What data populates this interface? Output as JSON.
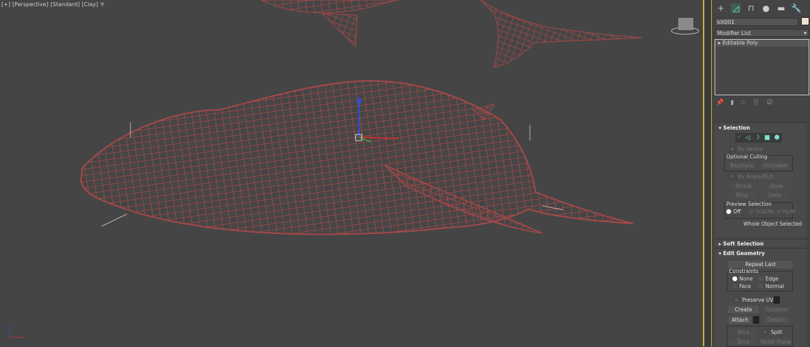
{
  "viewport": {
    "labels": [
      "[+]",
      "[Perspective]",
      "[Standard]",
      "[Clay]"
    ],
    "filter_icon": "funnel-icon",
    "wire_color": "#a84848"
  },
  "panel": {
    "tabs": [
      "create-icon",
      "modify-icon",
      "hierarchy-icon",
      "motion-icon",
      "display-icon",
      "utilities-icon"
    ],
    "object_name": "kit001",
    "object_color": "#efe0d0",
    "modifier_list": "Modifier List",
    "stack": [
      {
        "label": "Editable Poly"
      }
    ],
    "selection": {
      "title": "Selection",
      "by_vertex": "By Vertex",
      "optional_culling": "Optional Culling",
      "backface": "Backface",
      "occluded": "Occluded",
      "by_angle": "By Angle:",
      "angle_value": "45,0",
      "shrink": "Shrink",
      "grow": "Grow",
      "ring": "Ring",
      "loop": "Loop",
      "preview_selection": "Preview Selection",
      "off": "Off",
      "subobj": "SubObj",
      "multi": "Multi",
      "status": "Whole Object Selected"
    },
    "soft_selection": {
      "title": "Soft Selection"
    },
    "edit_geometry": {
      "title": "Edit Geometry",
      "repeat_last": "Repeat Last",
      "constraints": "Constraints",
      "none": "None",
      "edge": "Edge",
      "face": "Face",
      "normal": "Normal",
      "preserve_uvs": "Preserve UVs",
      "create": "Create",
      "collapse": "Collapse",
      "attach": "Attach",
      "detach": "Detach",
      "slice_plane": "Slice Plane",
      "split": "Split",
      "slice": "Slice",
      "reset_plane": "Reset Plane"
    }
  }
}
